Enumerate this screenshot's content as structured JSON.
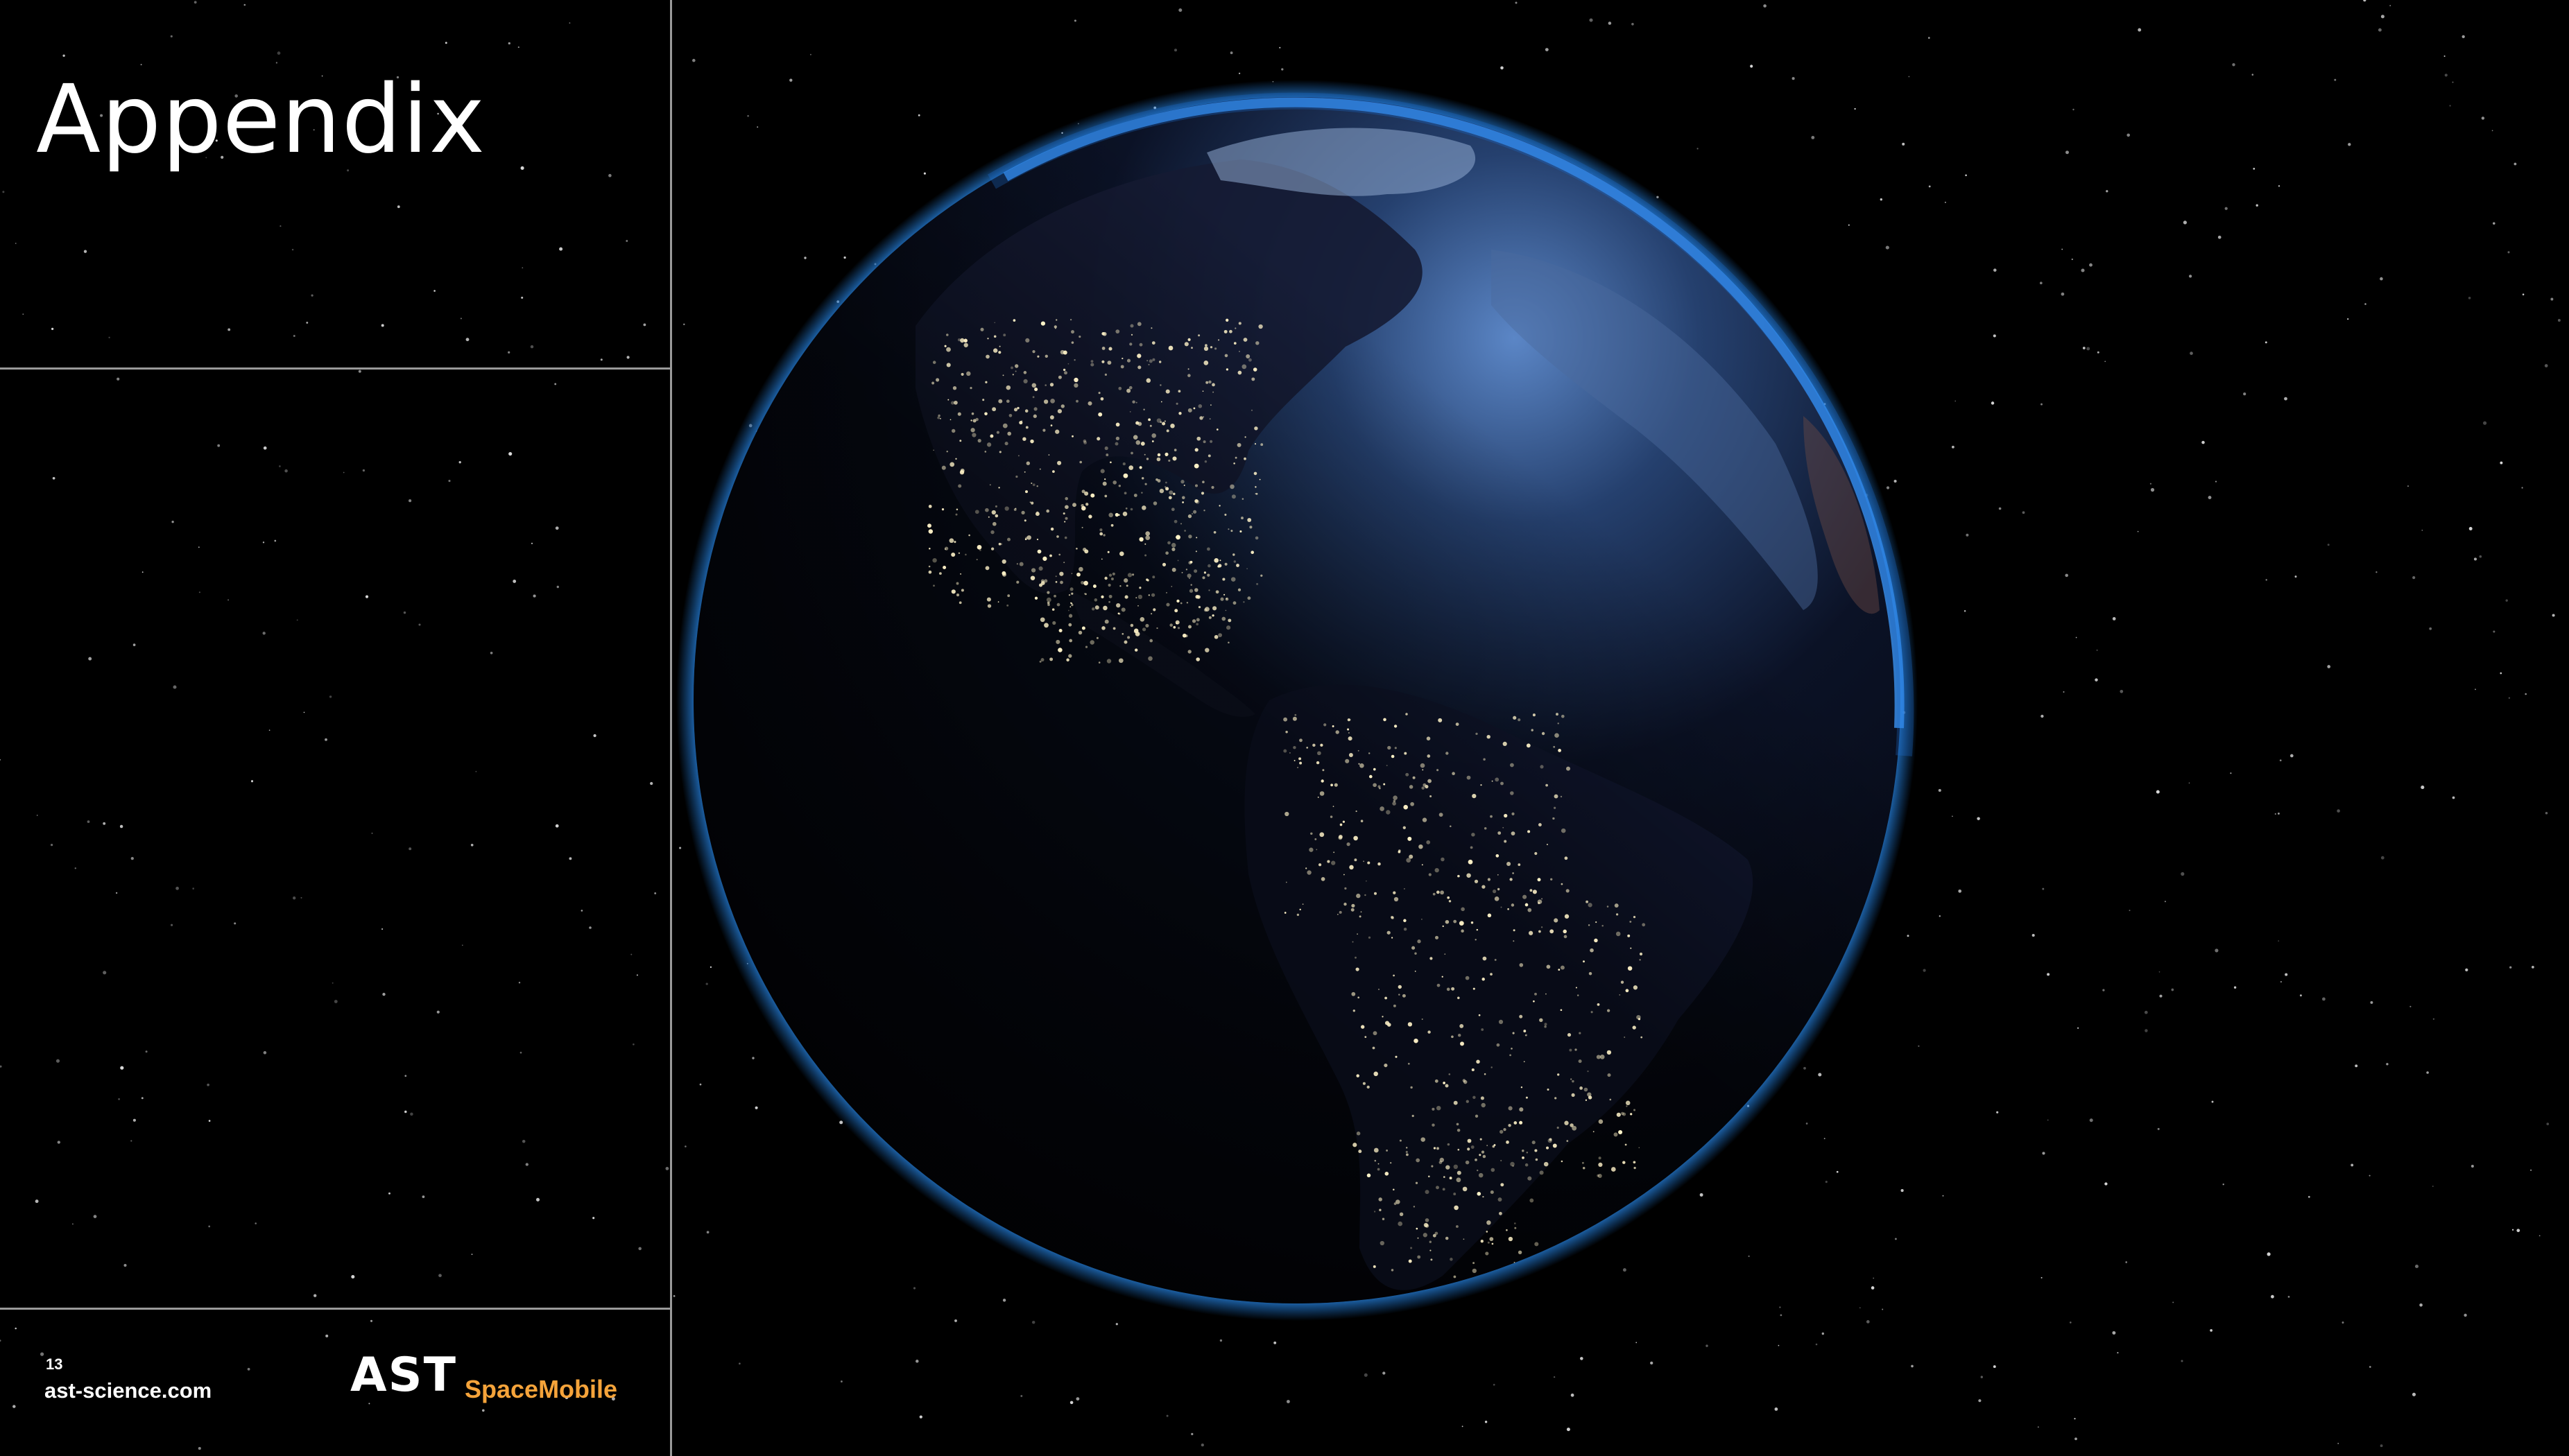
{
  "slide": {
    "title": "Appendix",
    "page_number": "13",
    "website": "ast-science.com"
  },
  "logo": {
    "primary_text": "AST",
    "secondary_text": "SpaceMobile",
    "primary_color": "#ffffff",
    "secondary_color": "#f5a33a"
  },
  "colors": {
    "background": "#000000",
    "divider": "#9a9a9a",
    "atmosphere": "#1f78d6",
    "city_lights": "#fff3c8"
  },
  "image": {
    "subject": "earth-night-globe-icon"
  }
}
